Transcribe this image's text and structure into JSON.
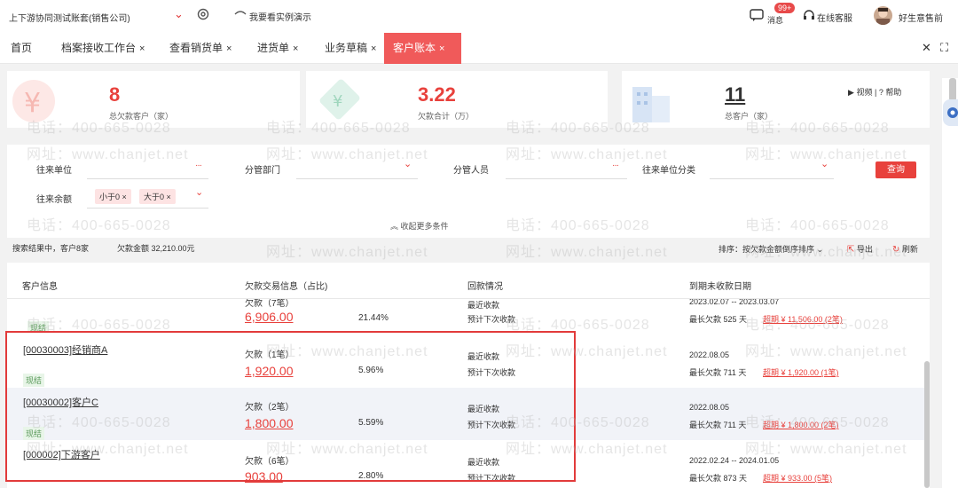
{
  "topbar": {
    "account": "上下游协同测试账套(销售公司)",
    "demo": "我要看实例演示",
    "messages_badge": "99+",
    "messages_label": "消息",
    "customer_service": "在线客服",
    "user": "好生意售前"
  },
  "tabs": [
    {
      "label": "首页",
      "closable": false
    },
    {
      "label": "档案接收工作台",
      "closable": true
    },
    {
      "label": "查看销货单",
      "closable": true
    },
    {
      "label": "进货单",
      "closable": true
    },
    {
      "label": "业务草稿",
      "closable": true
    },
    {
      "label": "客户账本",
      "closable": true,
      "active": true
    }
  ],
  "tab_close_glyph": "×",
  "window_buttons": {
    "close": "✕",
    "expand": "⛶"
  },
  "stats": [
    {
      "value": "8",
      "label": "总欠款客户（家）"
    },
    {
      "value": "3.22",
      "label": "欠款合计（万）"
    },
    {
      "value": "11",
      "label": "总客户（家）"
    }
  ],
  "help": {
    "video": "视频",
    "sep": "|",
    "help": "帮助"
  },
  "filters": {
    "partner": "往来单位",
    "department": "分管部门",
    "staff": "分管人员",
    "partner_category": "往来单位分类",
    "balance": "往来余额",
    "balance_tags": [
      "小于0",
      "大于0"
    ],
    "dots": "···",
    "query_button": "查询",
    "collapse": "收起更多条件"
  },
  "result": {
    "summary": "搜索结果中，客户8家",
    "debt_total": "欠款金额 32,210.00元",
    "sort": "排序：按欠款金额倒序排序",
    "export": "导出",
    "refresh": "刷新"
  },
  "table": {
    "headers": [
      "客户信息",
      "欠款交易信息（占比)",
      "回款情况",
      "到期未收款日期"
    ],
    "partial_row": {
      "debt_label": "欠款（7笔）",
      "amount": "6,906.00",
      "pct": "21.44%",
      "recent": "最近收款",
      "next": "预计下次收款",
      "date": "2023.02.07 -- 2023.03.07",
      "longest": "最长欠款 525 天",
      "overdue": "超期 ¥ 11,506.00 (2笔)",
      "status": "现结"
    },
    "rows": [
      {
        "name": "[00030003]经销商A",
        "status": "现结",
        "debt_label": "欠款（1笔）",
        "amount": "1,920.00",
        "pct": "5.96%",
        "recent": "最近收款",
        "next": "预计下次收款",
        "date": "2022.08.05",
        "longest": "最长欠款 711 天",
        "overdue": "超期 ¥ 1,920.00 (1笔)"
      },
      {
        "name": "[00030002]客户C",
        "status": "现结",
        "debt_label": "欠款（2笔）",
        "amount": "1,800.00",
        "pct": "5.59%",
        "recent": "最近收款",
        "next": "预计下次收款",
        "date": "2022.08.05",
        "longest": "最长欠款 711 天",
        "overdue": "超期 ¥ 1,800.00 (2笔)"
      },
      {
        "name": "[000002]下游客户",
        "status": "",
        "debt_label": "欠款（6笔）",
        "amount": "903.00",
        "pct": "2.80%",
        "recent": "最近收款",
        "next": "预计下次收款",
        "date": "2022.02.24 -- 2024.01.05",
        "longest": "最长欠款 873 天",
        "overdue": "超期 ¥ 933.00 (5笔)"
      }
    ]
  },
  "watermark": {
    "phone": "电话：400-665-0028",
    "site": "网址：www.chanjet.net"
  },
  "colors": {
    "accent": "#e8413c",
    "tab_active": "#f05a5a",
    "highlight_row": "#f1f3f8"
  }
}
